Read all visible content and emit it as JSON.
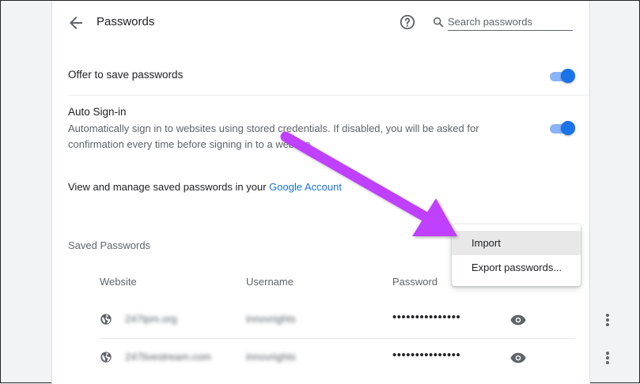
{
  "header": {
    "title": "Passwords",
    "search_placeholder": "Search passwords",
    "back_icon": "arrow-back-icon",
    "help_icon": "help-icon",
    "search_icon": "search-icon"
  },
  "settings": {
    "offer_to_save": {
      "label": "Offer to save passwords",
      "enabled": true
    },
    "auto_sign_in": {
      "label": "Auto Sign-in",
      "description": "Automatically sign in to websites using stored credentials. If disabled, you will be asked for confirmation every time before signing in to a website.",
      "enabled": true
    },
    "manage": {
      "text": "View and manage saved passwords in your ",
      "link": "Google Account"
    }
  },
  "saved_passwords": {
    "title": "Saved Passwords",
    "columns": [
      "Website",
      "Username",
      "Password"
    ],
    "rows": [
      {
        "website": "247tpm.org",
        "username": "innovrights",
        "password": "•••••••••••••••"
      },
      {
        "website": "247livestream.com",
        "username": "innovrights",
        "password": "•••••••••••••••"
      }
    ]
  },
  "menu": {
    "items": [
      "Import",
      "Export passwords..."
    ],
    "highlighted": "Import"
  },
  "colors": {
    "accent": "#1a73e8",
    "toggle_track": "#8ab4f8",
    "annotation_arrow": "#c040ff"
  }
}
